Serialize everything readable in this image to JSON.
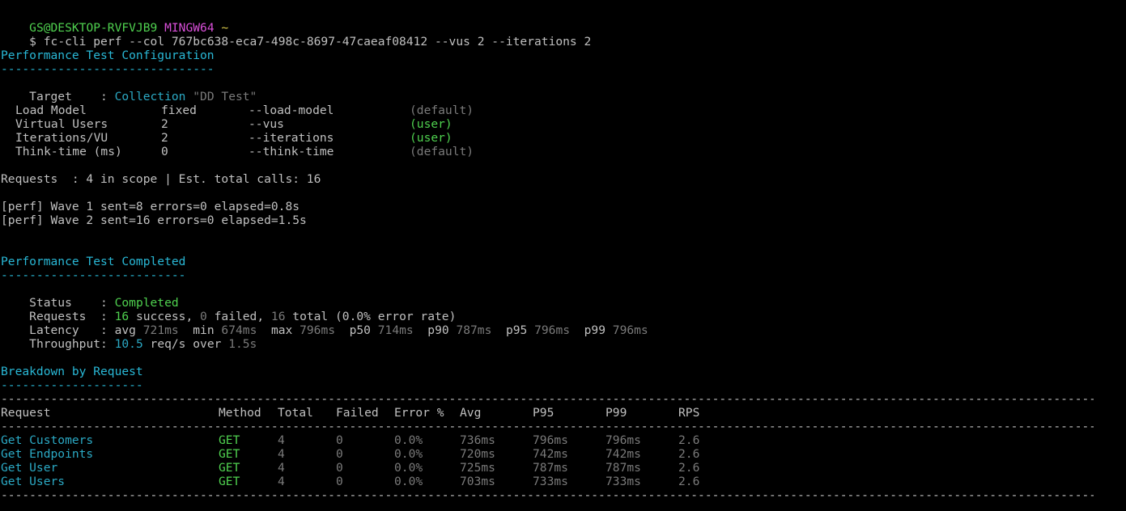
{
  "prompt": {
    "user_host": "GS@DESKTOP-RVFVJB9",
    "shell": "MINGW64",
    "path": "~",
    "symbol": "$",
    "command": "fc-cli perf --col 767bc638-eca7-498c-8697-47caeaf08412 --vus 2 --iterations 2"
  },
  "config": {
    "title": "Performance Test Configuration",
    "underline": "------------------------------",
    "target_label": "Target    : ",
    "target_kind": "Collection",
    "target_name": "\"DD Test\"",
    "params": [
      {
        "name": "Load Model",
        "value": "fixed",
        "flag": "--load-model",
        "source": "(default)"
      },
      {
        "name": "Virtual Users",
        "value": "2",
        "flag": "--vus",
        "source": "(user)"
      },
      {
        "name": "Iterations/VU",
        "value": "2",
        "flag": "--iterations",
        "source": "(user)"
      },
      {
        "name": "Think-time (ms)",
        "value": "0",
        "flag": "--think-time",
        "source": "(default)"
      }
    ],
    "requests_line": "Requests  : 4 in scope | Est. total calls: 16"
  },
  "waves": [
    "[perf] Wave 1 sent=8 errors=0 elapsed=0.8s",
    "[perf] Wave 2 sent=16 errors=0 elapsed=1.5s"
  ],
  "completed": {
    "title": "Performance Test Completed",
    "underline": "--------------------------",
    "status_label": "Status    : ",
    "status_value": "Completed",
    "requests_label": "Requests  : ",
    "success_count": "16",
    "success_text": " success, ",
    "failed_count": "0",
    "failed_text": " failed, ",
    "total_count": "16",
    "total_text": " total (0.0% error rate)",
    "latency_label": "Latency   : ",
    "latency": [
      {
        "key": "avg",
        "value": "721ms"
      },
      {
        "key": "min",
        "value": "674ms"
      },
      {
        "key": "max",
        "value": "796ms"
      },
      {
        "key": "p50",
        "value": "714ms"
      },
      {
        "key": "p90",
        "value": "787ms"
      },
      {
        "key": "p95",
        "value": "796ms"
      },
      {
        "key": "p99",
        "value": "796ms"
      }
    ],
    "throughput_label": "Throughput: ",
    "throughput_value": "10.5",
    "throughput_unit": " req/s over ",
    "throughput_duration": "1.5s"
  },
  "breakdown": {
    "title": "Breakdown by Request",
    "underline": "--------------------",
    "columns": [
      "Request",
      "Method",
      "Total",
      "Failed",
      "Error %",
      "Avg",
      "P95",
      "P99",
      "RPS"
    ],
    "rows": [
      {
        "request": "Get Customers",
        "method": "GET",
        "total": "4",
        "failed": "0",
        "error": "0.0%",
        "avg": "736ms",
        "p95": "796ms",
        "p99": "796ms",
        "rps": "2.6"
      },
      {
        "request": "Get Endpoints",
        "method": "GET",
        "total": "4",
        "failed": "0",
        "error": "0.0%",
        "avg": "720ms",
        "p95": "742ms",
        "p99": "742ms",
        "rps": "2.6"
      },
      {
        "request": "Get User",
        "method": "GET",
        "total": "4",
        "failed": "0",
        "error": "0.0%",
        "avg": "725ms",
        "p95": "787ms",
        "p99": "787ms",
        "rps": "2.6"
      },
      {
        "request": "Get Users",
        "method": "GET",
        "total": "4",
        "failed": "0",
        "error": "0.0%",
        "avg": "703ms",
        "p95": "733ms",
        "p99": "733ms",
        "rps": "2.6"
      }
    ],
    "rule": "------------------------------------------------------------------------------------------------------------------------------------------------------------"
  },
  "colors": {
    "background": "#000000",
    "text": "#c0c0c0",
    "cyan": "#29b8d6",
    "green": "#4fd14f",
    "magenta": "#d94fd9",
    "yellow": "#d8c84a",
    "dim": "#7a7a7a"
  }
}
